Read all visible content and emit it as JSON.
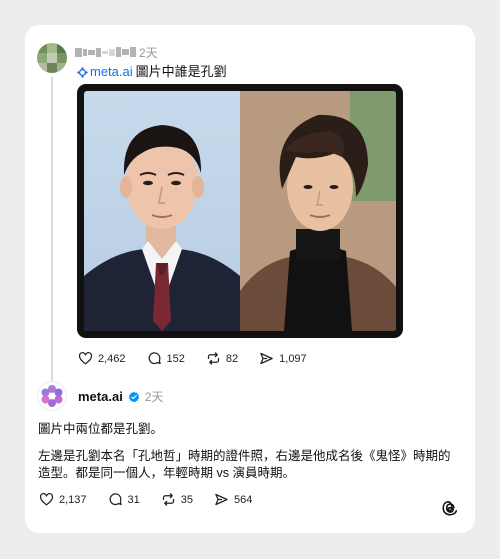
{
  "post": {
    "username_obscured": "pixelated",
    "time": "2天",
    "mention": "meta.ai",
    "text": "圖片中誰是孔劉",
    "image_alt": "two portrait photos side by side",
    "stats": {
      "likes": "2,462",
      "comments": "152",
      "reposts": "82",
      "shares": "1,097"
    }
  },
  "reply": {
    "username": "meta.ai",
    "time": "2天",
    "paragraph1": "圖片中兩位都是孔劉。",
    "paragraph2": "左邊是孔劉本名「孔地哲」時期的證件照，右邊是他成名後《鬼怪》時期的造型。都是同一個人，年輕時期 vs 演員時期。",
    "stats": {
      "likes": "2,137",
      "comments": "31",
      "reposts": "35",
      "shares": "564"
    }
  },
  "colors": {
    "accent": "#1a6fe0",
    "verified": "#0095f6",
    "muted": "#999999",
    "background": "#ededed",
    "card": "#ffffff"
  },
  "icons": [
    "heart-icon",
    "comment-icon",
    "repost-icon",
    "share-icon",
    "verified-badge-icon",
    "meta-ai-icon",
    "threads-logo-icon"
  ]
}
